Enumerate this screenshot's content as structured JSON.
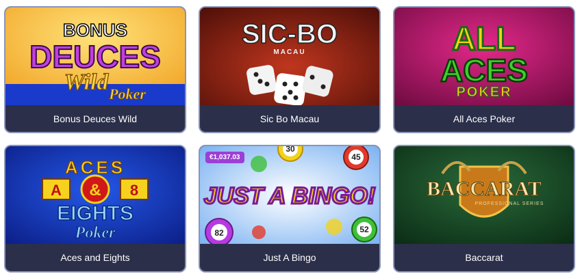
{
  "games": [
    {
      "title": "Bonus Deuces Wild",
      "art": [
        "BONUS",
        "DEUCES",
        "Wild",
        "Poker"
      ]
    },
    {
      "title": "Sic Bo Macau",
      "art": [
        "SIC-BO",
        "MACAU"
      ]
    },
    {
      "title": "All Aces Poker",
      "art": [
        "ALL",
        "ACES",
        "POKER"
      ]
    },
    {
      "title": "Aces and Eights",
      "art": [
        "ACES",
        "A",
        "&",
        "8",
        "EIGHTS",
        "Poker"
      ]
    },
    {
      "title": "Just A Bingo",
      "art": [
        "JUST A BINGO!",
        "30",
        "45",
        "82",
        "52"
      ],
      "jackpot": "€1,037.03"
    },
    {
      "title": "Baccarat",
      "art": [
        "BACCARAT",
        "PROFESSIONAL SERIES"
      ]
    }
  ]
}
